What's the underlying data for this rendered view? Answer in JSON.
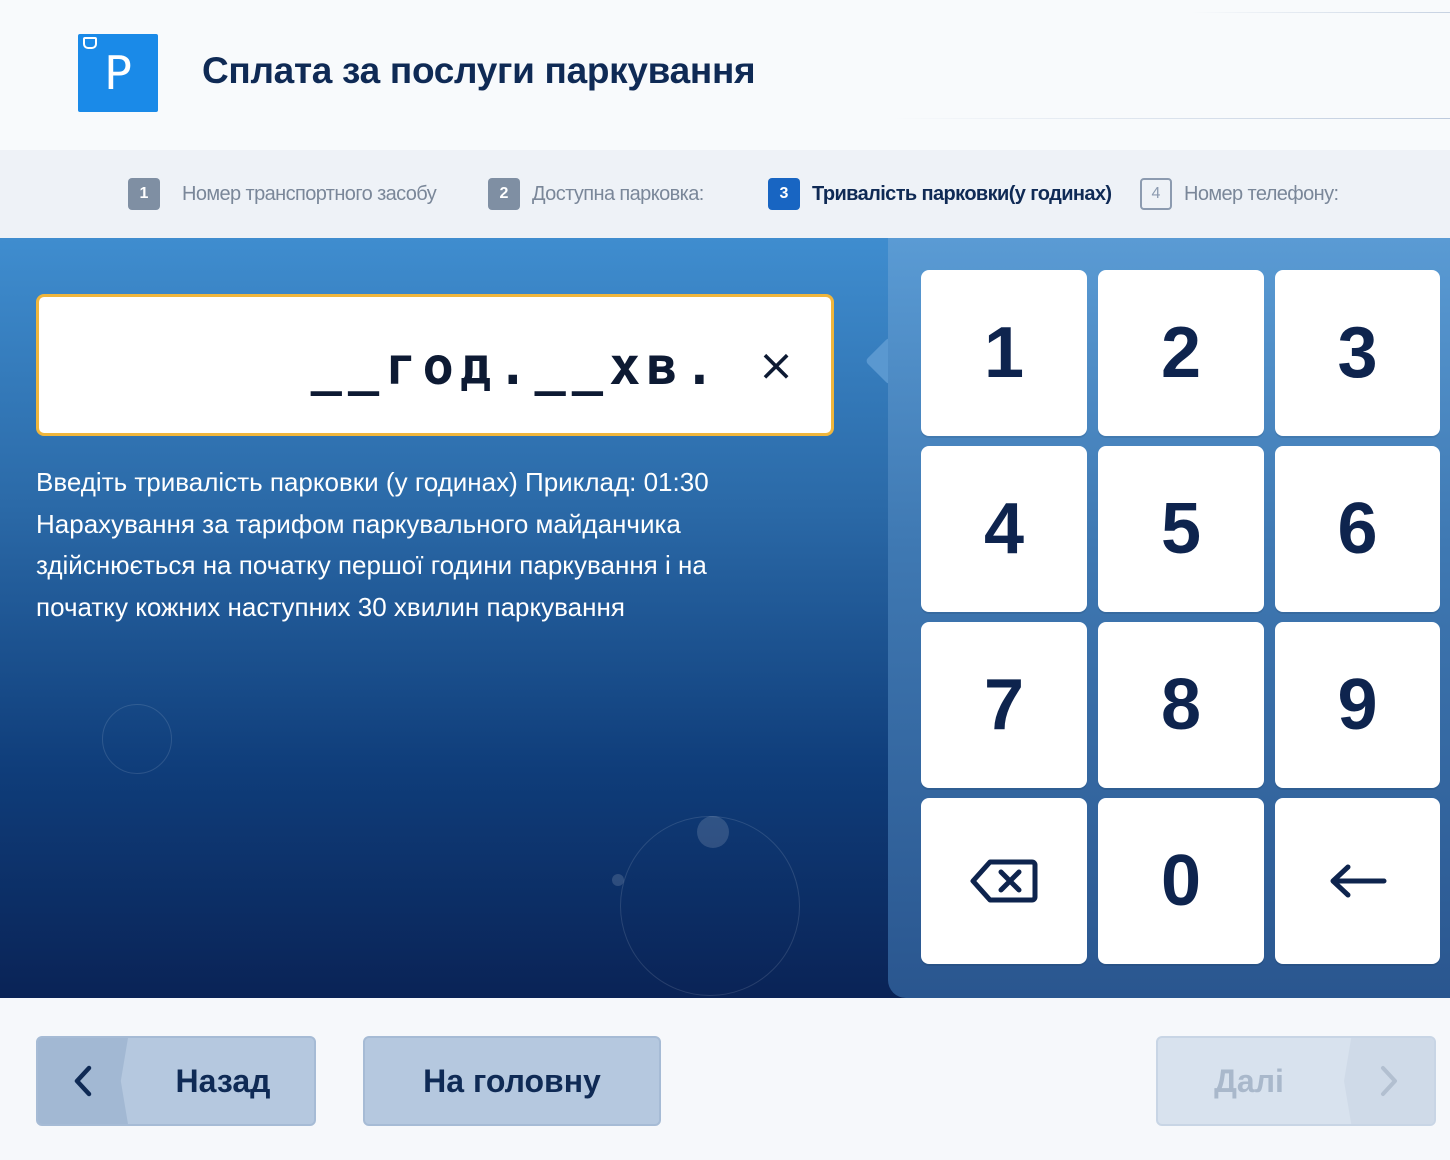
{
  "header": {
    "logo_letter": "P",
    "title": "Сплата за послуги паркування"
  },
  "stepper": {
    "steps": [
      {
        "num": "1",
        "label": "Номер транспортного засобу",
        "state": "done"
      },
      {
        "num": "2",
        "label": "Доступна парковка:",
        "state": "done"
      },
      {
        "num": "3",
        "label": "Тривалість парковки(у годинах)",
        "state": "active"
      },
      {
        "num": "4",
        "label": "Номер телефону:",
        "state": "future"
      }
    ]
  },
  "duration_input": {
    "value": "__год.__хв.",
    "clear_symbol": "×"
  },
  "hint": {
    "lines": [
      "Введіть тривалість парковки (у годинах) Приклад: 01:30",
      "Нарахування за тарифом паркувального майданчика",
      "здійснюється на початку першої години паркування і на",
      "початку кожних наступних  30 хвилин паркування"
    ]
  },
  "keypad": {
    "keys": [
      "1",
      "2",
      "3",
      "4",
      "5",
      "6",
      "7",
      "8",
      "9",
      "",
      "0",
      ""
    ],
    "backspace_icon": "backspace-icon",
    "enter_icon": "arrow-left-icon"
  },
  "footer": {
    "back_label": "Назад",
    "home_label": "На головну",
    "next_label": "Далі"
  },
  "colors": {
    "accent": "#1a8ae8",
    "active_step": "#1865c2",
    "input_border": "#f0b63c",
    "text_dark": "#0f2a55"
  }
}
